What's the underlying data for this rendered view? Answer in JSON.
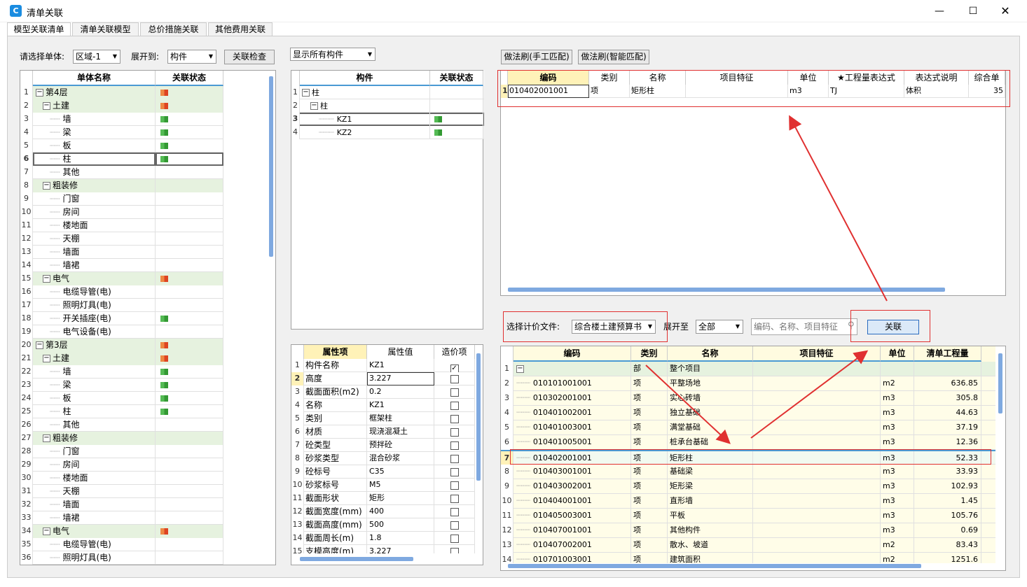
{
  "window": {
    "title": "清单关联"
  },
  "tabs": [
    "模型关联清单",
    "清单关联模型",
    "总价措施关联",
    "其他费用关联"
  ],
  "left": {
    "unit_label": "请选择单体:",
    "unit_value": "区域-1",
    "expand_label": "展开到:",
    "expand_value": "构件",
    "check_btn": "关联检查",
    "headers": [
      "单体名称",
      "关联状态"
    ],
    "rows": [
      {
        "n": "1",
        "t": "第4层",
        "lv": 0,
        "tg": "-",
        "f": "r",
        "g": 1
      },
      {
        "n": "2",
        "t": "土建",
        "lv": 1,
        "tg": "-",
        "f": "r",
        "g": 1
      },
      {
        "n": "3",
        "t": "墙",
        "lv": 2,
        "f": "g"
      },
      {
        "n": "4",
        "t": "梁",
        "lv": 2,
        "f": "g"
      },
      {
        "n": "5",
        "t": "板",
        "lv": 2,
        "f": "g"
      },
      {
        "n": "6",
        "t": "柱",
        "lv": 2,
        "f": "g",
        "sel": 1
      },
      {
        "n": "7",
        "t": "其他",
        "lv": 2
      },
      {
        "n": "8",
        "t": "粗装修",
        "lv": 1,
        "tg": "-",
        "g": 1
      },
      {
        "n": "9",
        "t": "门窗",
        "lv": 2
      },
      {
        "n": "10",
        "t": "房间",
        "lv": 2
      },
      {
        "n": "11",
        "t": "楼地面",
        "lv": 2
      },
      {
        "n": "12",
        "t": "天棚",
        "lv": 2
      },
      {
        "n": "13",
        "t": "墙面",
        "lv": 2
      },
      {
        "n": "14",
        "t": "墙裙",
        "lv": 2
      },
      {
        "n": "15",
        "t": "电气",
        "lv": 1,
        "tg": "-",
        "f": "r",
        "g": 1
      },
      {
        "n": "16",
        "t": "电缆导管(电)",
        "lv": 2
      },
      {
        "n": "17",
        "t": "照明灯具(电)",
        "lv": 2
      },
      {
        "n": "18",
        "t": "开关插座(电)",
        "lv": 2,
        "f": "g"
      },
      {
        "n": "19",
        "t": "电气设备(电)",
        "lv": 2
      },
      {
        "n": "20",
        "t": "第3层",
        "lv": 0,
        "tg": "-",
        "f": "r",
        "g": 1
      },
      {
        "n": "21",
        "t": "土建",
        "lv": 1,
        "tg": "-",
        "f": "r",
        "g": 1
      },
      {
        "n": "22",
        "t": "墙",
        "lv": 2,
        "f": "g"
      },
      {
        "n": "23",
        "t": "梁",
        "lv": 2,
        "f": "g"
      },
      {
        "n": "24",
        "t": "板",
        "lv": 2,
        "f": "g"
      },
      {
        "n": "25",
        "t": "柱",
        "lv": 2,
        "f": "g"
      },
      {
        "n": "26",
        "t": "其他",
        "lv": 2
      },
      {
        "n": "27",
        "t": "粗装修",
        "lv": 1,
        "tg": "-",
        "g": 1
      },
      {
        "n": "28",
        "t": "门窗",
        "lv": 2
      },
      {
        "n": "29",
        "t": "房间",
        "lv": 2
      },
      {
        "n": "30",
        "t": "楼地面",
        "lv": 2
      },
      {
        "n": "31",
        "t": "天棚",
        "lv": 2
      },
      {
        "n": "32",
        "t": "墙面",
        "lv": 2
      },
      {
        "n": "33",
        "t": "墙裙",
        "lv": 2
      },
      {
        "n": "34",
        "t": "电气",
        "lv": 1,
        "tg": "-",
        "f": "r",
        "g": 1
      },
      {
        "n": "35",
        "t": "电缆导管(电)",
        "lv": 2
      },
      {
        "n": "36",
        "t": "照明灯具(电)",
        "lv": 2
      }
    ]
  },
  "middle": {
    "filter_value": "显示所有构件",
    "headers": [
      "构件",
      "关联状态"
    ],
    "rows": [
      {
        "n": "1",
        "t": "柱",
        "lv": 0,
        "tg": "-"
      },
      {
        "n": "2",
        "t": "柱",
        "lv": 1,
        "tg": "-"
      },
      {
        "n": "3",
        "t": "KZ1",
        "lv": 2,
        "f": "g",
        "sel": 1
      },
      {
        "n": "4",
        "t": "KZ2",
        "lv": 2,
        "f": "g"
      }
    ],
    "prop_headers": [
      "属性项",
      "属性值",
      "造价项"
    ],
    "props": [
      {
        "n": "1",
        "k": "构件名称",
        "v": "KZ1",
        "c": 1
      },
      {
        "n": "2",
        "k": "高度",
        "v": "3.227",
        "c": 0,
        "sel": 1
      },
      {
        "n": "3",
        "k": "截面面积(m2)",
        "v": "0.2",
        "c": 0
      },
      {
        "n": "4",
        "k": "名称",
        "v": "KZ1",
        "c": 0
      },
      {
        "n": "5",
        "k": "类别",
        "v": "框架柱",
        "c": 0
      },
      {
        "n": "6",
        "k": "材质",
        "v": "现浇混凝土",
        "c": 0
      },
      {
        "n": "7",
        "k": "砼类型",
        "v": "预拌砼",
        "c": 0
      },
      {
        "n": "8",
        "k": "砂浆类型",
        "v": "混合砂浆",
        "c": 0
      },
      {
        "n": "9",
        "k": "砼标号",
        "v": "C35",
        "c": 0
      },
      {
        "n": "10",
        "k": "砂浆标号",
        "v": "M5",
        "c": 0
      },
      {
        "n": "11",
        "k": "截面形状",
        "v": "矩形",
        "c": 0
      },
      {
        "n": "12",
        "k": "截面宽度(mm)",
        "v": "400",
        "c": 0
      },
      {
        "n": "13",
        "k": "截面高度(mm)",
        "v": "500",
        "c": 0
      },
      {
        "n": "14",
        "k": "截面周长(m)",
        "v": "1.8",
        "c": 0
      },
      {
        "n": "15",
        "k": "支模高度(m)",
        "v": "3.227",
        "c": 0
      }
    ]
  },
  "right_top": {
    "btn_manual": "做法刷(手工匹配)",
    "btn_smart": "做法刷(智能匹配)",
    "headers": [
      "编码",
      "类别",
      "名称",
      "项目特征",
      "单位",
      "★工程量表达式",
      "表达式说明",
      "综合单"
    ],
    "rows": [
      {
        "n": "1",
        "code": "010402001001",
        "type": "项",
        "name": "矩形柱",
        "feat": "",
        "unit": "m3",
        "expr": "TJ",
        "desc": "体积",
        "price": "35"
      }
    ]
  },
  "right_bottom": {
    "file_label": "选择计价文件:",
    "file_value": "综合楼土建预算书",
    "expand_label": "展开至",
    "expand_value": "全部",
    "search_placeholder": "编码、名称、项目特征",
    "link_btn": "关联",
    "headers": [
      "编码",
      "类别",
      "名称",
      "项目特征",
      "单位",
      "清单工程量"
    ],
    "rows": [
      {
        "n": "1",
        "code": "",
        "type": "部",
        "name": "整个项目",
        "unit": "",
        "qty": "",
        "top": 1
      },
      {
        "n": "2",
        "code": "010101001001",
        "type": "项",
        "name": "平整场地",
        "unit": "m2",
        "qty": "636.85"
      },
      {
        "n": "3",
        "code": "010302001001",
        "type": "项",
        "name": "实心砖墙",
        "unit": "m3",
        "qty": "305.8"
      },
      {
        "n": "4",
        "code": "010401002001",
        "type": "项",
        "name": "独立基础",
        "unit": "m3",
        "qty": "44.63"
      },
      {
        "n": "5",
        "code": "010401003001",
        "type": "项",
        "name": "满堂基础",
        "unit": "m3",
        "qty": "37.19"
      },
      {
        "n": "6",
        "code": "010401005001",
        "type": "项",
        "name": "桩承台基础",
        "unit": "m3",
        "qty": "12.36"
      },
      {
        "n": "7",
        "code": "010402001001",
        "type": "项",
        "name": "矩形柱",
        "unit": "m3",
        "qty": "52.33",
        "sel": 1
      },
      {
        "n": "8",
        "code": "010403001001",
        "type": "项",
        "name": "基础梁",
        "unit": "m3",
        "qty": "33.93"
      },
      {
        "n": "9",
        "code": "010403002001",
        "type": "项",
        "name": "矩形梁",
        "unit": "m3",
        "qty": "102.93"
      },
      {
        "n": "10",
        "code": "010404001001",
        "type": "项",
        "name": "直形墙",
        "unit": "m3",
        "qty": "1.45"
      },
      {
        "n": "11",
        "code": "010405003001",
        "type": "项",
        "name": "平板",
        "unit": "m3",
        "qty": "105.76"
      },
      {
        "n": "12",
        "code": "010407001001",
        "type": "项",
        "name": "其他构件",
        "unit": "m3",
        "qty": "0.69"
      },
      {
        "n": "13",
        "code": "010407002001",
        "type": "项",
        "name": "散水、坡道",
        "unit": "m2",
        "qty": "83.43"
      },
      {
        "n": "14",
        "code": "010701003001",
        "type": "项",
        "name": "建筑面积",
        "unit": "m2",
        "qty": "1251.6"
      }
    ]
  }
}
